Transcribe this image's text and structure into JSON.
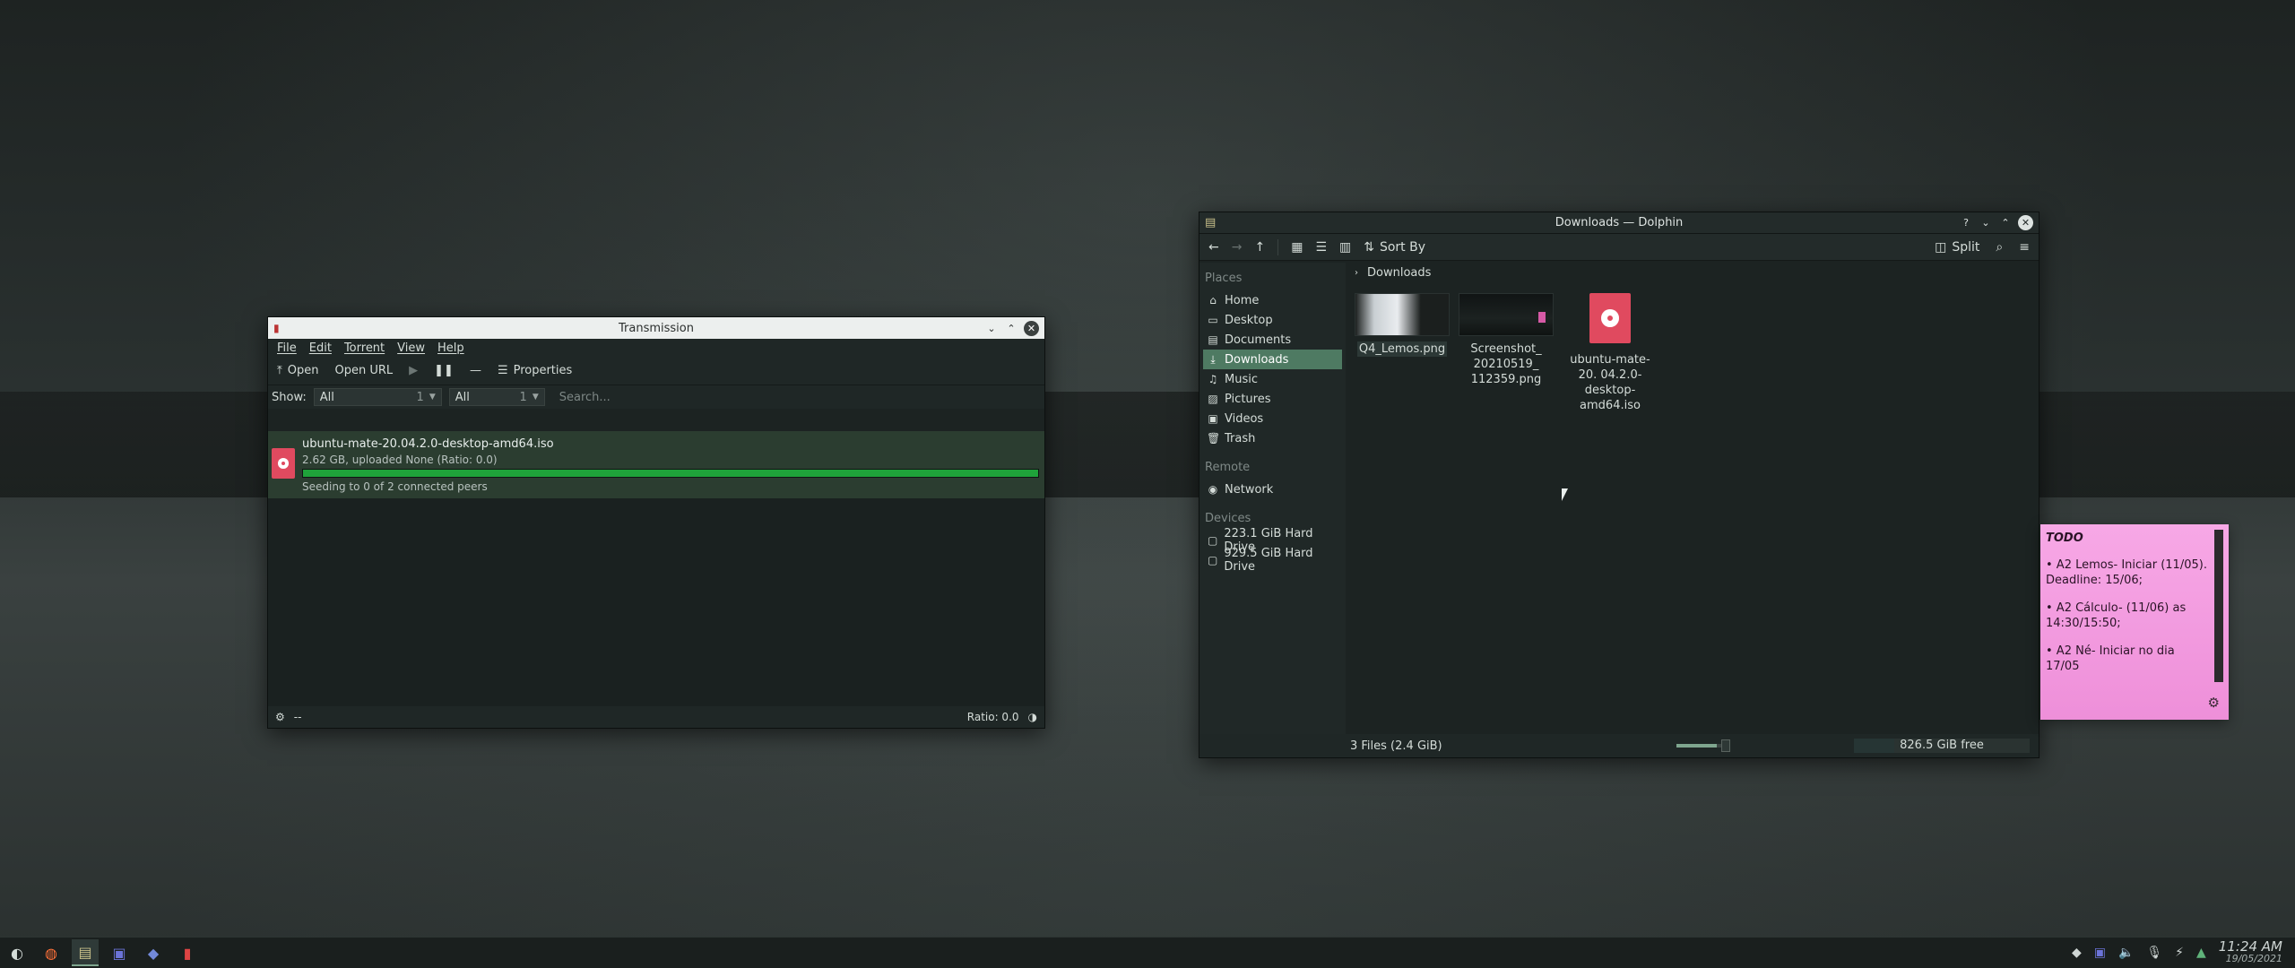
{
  "transmission": {
    "title": "Transmission",
    "menu": [
      "File",
      "Edit",
      "Torrent",
      "View",
      "Help"
    ],
    "toolbar": {
      "open": "Open",
      "open_url": "Open URL",
      "properties": "Properties"
    },
    "filter": {
      "show_label": "Show:",
      "status_filter": "All",
      "status_count": "1",
      "tracker_filter": "All",
      "tracker_count": "1",
      "search_placeholder": "Search..."
    },
    "torrent": {
      "name": "ubuntu-mate-20.04.2.0-desktop-amd64.iso",
      "meta": "2.62 GB, uploaded None (Ratio: 0.0)",
      "progress": 1.0,
      "status": "Seeding to 0 of 2 connected peers"
    },
    "statusbar": {
      "speed": "--",
      "ratio": "Ratio: 0.0"
    }
  },
  "dolphin": {
    "title": "Downloads — Dolphin",
    "toolbar": {
      "sort_by": "Sort By",
      "split": "Split"
    },
    "places_title": "Places",
    "places": [
      {
        "label": "Home",
        "icon": "home-icon"
      },
      {
        "label": "Desktop",
        "icon": "desktop-icon"
      },
      {
        "label": "Documents",
        "icon": "documents-icon"
      },
      {
        "label": "Downloads",
        "icon": "downloads-icon",
        "active": true
      },
      {
        "label": "Music",
        "icon": "music-icon"
      },
      {
        "label": "Pictures",
        "icon": "pictures-icon"
      },
      {
        "label": "Videos",
        "icon": "videos-icon"
      },
      {
        "label": "Trash",
        "icon": "trash-icon"
      }
    ],
    "remote_title": "Remote",
    "remote": [
      {
        "label": "Network",
        "icon": "network-icon"
      }
    ],
    "devices_title": "Devices",
    "devices": [
      {
        "label": "223.1 GiB Hard Drive",
        "icon": "drive-icon"
      },
      {
        "label": "929.5 GiB Hard Drive",
        "icon": "drive-icon"
      }
    ],
    "breadcrumb": "Downloads",
    "files": [
      {
        "name": "Q4_Lemos.png",
        "type": "image"
      },
      {
        "name": "Screenshot_ 20210519_ 112359.png",
        "type": "image"
      },
      {
        "name": "ubuntu-mate-20. 04.2.0-desktop- amd64.iso",
        "type": "iso"
      }
    ],
    "status": {
      "count": "3 Files (2.4 GiB)",
      "free": "826.5 GiB free"
    }
  },
  "sticky": {
    "title": "TODO",
    "items": [
      "• A2 Lemos- Iniciar (11/05). Deadline: 15/06;",
      "• A2 Cálculo- (11/06) as 14:30/15:50;",
      "• A2 Né- Iniciar no dia 17/05"
    ]
  },
  "taskbar": {
    "time": "11:24 AM",
    "date": "19/05/2021"
  },
  "colors": {
    "accent": "#4e7a62",
    "progress": "#1fa33a",
    "sticky": "#f3a0e0"
  }
}
